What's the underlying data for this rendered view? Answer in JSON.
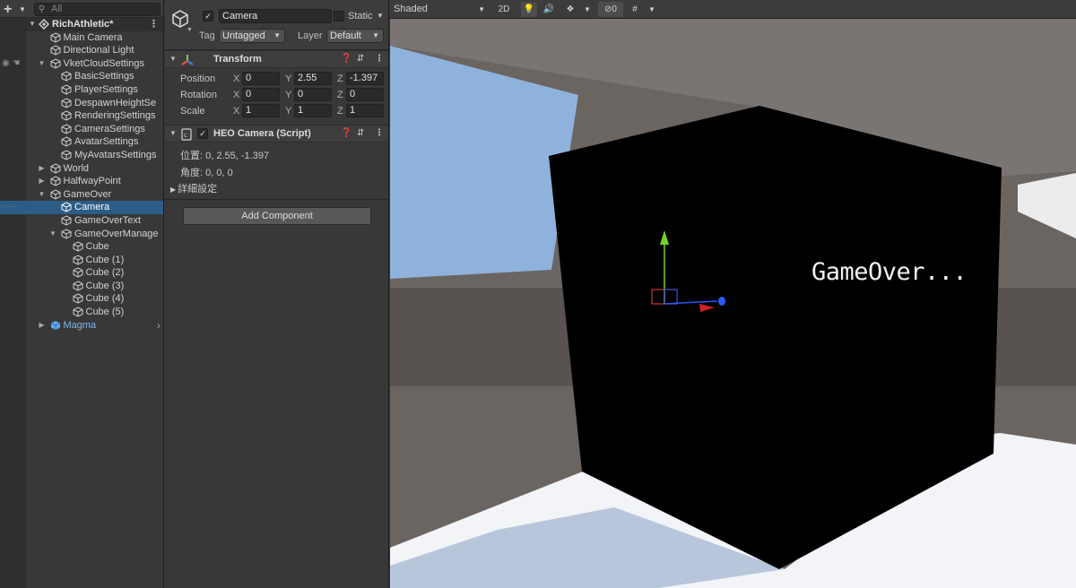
{
  "hierarchy": {
    "add_icon": "plus-icon",
    "search_placeholder": "All",
    "items": [
      {
        "label": "RichAthletic*",
        "kind": "scene"
      },
      {
        "label": "Main Camera"
      },
      {
        "label": "Directional Light"
      },
      {
        "label": "VketCloudSettings"
      },
      {
        "label": "BasicSettings"
      },
      {
        "label": "PlayerSettings"
      },
      {
        "label": "DespawnHeightSe"
      },
      {
        "label": "RenderingSettings"
      },
      {
        "label": "CameraSettings"
      },
      {
        "label": "AvatarSettings"
      },
      {
        "label": "MyAvatarsSettings"
      },
      {
        "label": "World"
      },
      {
        "label": "HalfwayPoint"
      },
      {
        "label": "GameOver"
      },
      {
        "label": "Camera",
        "selected": true
      },
      {
        "label": "GameOverText"
      },
      {
        "label": "GameOverManage"
      },
      {
        "label": "Cube"
      },
      {
        "label": "Cube (1)"
      },
      {
        "label": "Cube (2)"
      },
      {
        "label": "Cube (3)"
      },
      {
        "label": "Cube (4)"
      },
      {
        "label": "Cube (5)"
      },
      {
        "label": "Magma",
        "prefab": true
      }
    ]
  },
  "inspector": {
    "object_name": "Camera",
    "active": true,
    "static_label": "Static",
    "tag_label": "Tag",
    "tag_value": "Untagged",
    "layer_label": "Layer",
    "layer_value": "Default",
    "transform": {
      "title": "Transform",
      "position_label": "Position",
      "rotation_label": "Rotation",
      "scale_label": "Scale",
      "axis_x": "X",
      "axis_y": "Y",
      "axis_z": "Z",
      "position": {
        "x": "0",
        "y": "2.55",
        "z": "-1.397"
      },
      "rotation": {
        "x": "0",
        "y": "0",
        "z": "0"
      },
      "scale": {
        "x": "1",
        "y": "1",
        "z": "1"
      }
    },
    "script": {
      "title": "HEO Camera (Script)",
      "position_line": "位置: 0, 2.55, -1.397",
      "angle_line": "角度: 0, 0, 0",
      "details_label": "詳細設定"
    },
    "add_component_label": "Add Component"
  },
  "scene": {
    "shading_mode": "Shaded",
    "btn_2d": "2D",
    "hidden_count": "0",
    "overlay_text": "GameOver...",
    "colors": {
      "sky": "#8fb2dc",
      "floor": "#f2f4f8",
      "wall": "#6b6562",
      "cube": "#000000"
    }
  }
}
